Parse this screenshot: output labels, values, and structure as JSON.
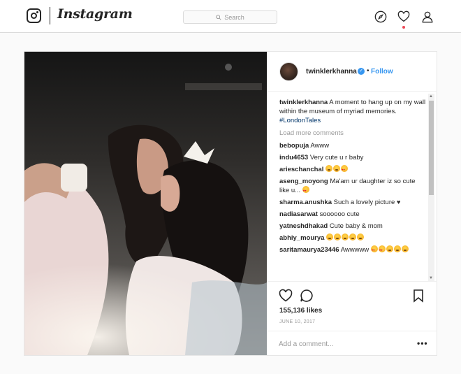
{
  "nav": {
    "wordmark": "Instagram",
    "search_placeholder": "Search",
    "icons": [
      "instagram-logo-icon",
      "search-icon",
      "compass-icon",
      "heart-icon",
      "profile-icon"
    ],
    "notification_dot_color": "#ed4956"
  },
  "post": {
    "username": "twinklerkhanna",
    "verified": true,
    "dot": "•",
    "follow_label": "Follow",
    "caption_user": "twinklerkhanna",
    "caption_text": "A moment to hang up on my wall within the museum of myriad memories.",
    "caption_tag": "#LondonTales",
    "load_more": "Load more comments",
    "comments": [
      {
        "user": "bebopuja",
        "text": "Awww"
      },
      {
        "user": "indu4653",
        "text": "Very cute u r baby"
      },
      {
        "user": "arieschanchal",
        "text": ""
      },
      {
        "user": "aseng_moyong",
        "text": "Ma'am ur daughter iz so cute like u..."
      },
      {
        "user": "sharma.anushka",
        "text": "Such a lovely picture"
      },
      {
        "user": "nadiasarwat",
        "text": "soooooo cute"
      },
      {
        "user": "yatneshdhakad",
        "text": "Cute baby & mom"
      },
      {
        "user": "abhiy_mourya",
        "text": ""
      },
      {
        "user": "saritamaurya23446",
        "text": "Awwwww"
      }
    ],
    "likes": "155,136 likes",
    "date": "JUNE 10, 2017",
    "add_comment_placeholder": "Add a comment...",
    "more_label": "•••",
    "accent_color": "#3897f0"
  }
}
